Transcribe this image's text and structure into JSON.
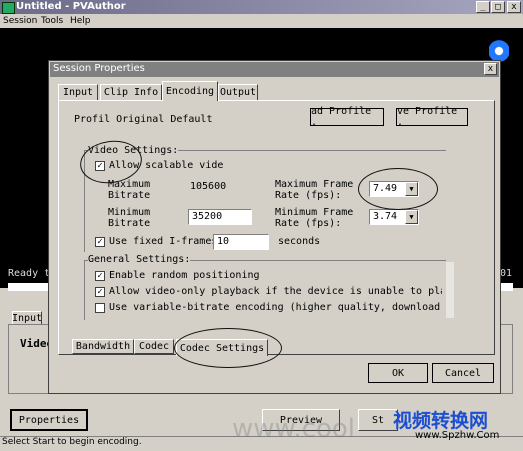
{
  "app": {
    "title": "Untitled - PVAuthor",
    "menu": [
      "Session",
      "Tools",
      "Help"
    ],
    "status_bar": "Select Start to begin encoding.",
    "video_status_left": "Ready t",
    "video_status_right": "01",
    "bottom_tab": "Input",
    "bottom_label": "Video",
    "properties_button": "Properties",
    "preview_button": "Preview",
    "start_button": "St",
    "window_controls": [
      "_",
      "□",
      "x"
    ]
  },
  "dialog": {
    "title": "Session Properties",
    "close": "x",
    "tabs": [
      "Input",
      "Clip Info",
      "Encoding",
      "Output"
    ],
    "active_tab": "Encoding",
    "profile_label": "Profil Original Default",
    "load_profile_button": "ad Profile .",
    "save_profile_button": "ve Profile .",
    "video_settings": {
      "legend": "Video Settings:",
      "allow_scalable": "Allow scalable vide",
      "allow_scalable_checked": true,
      "max_bitrate_label": "Maximum\nBitrate",
      "max_bitrate_value": "105600",
      "min_bitrate_label": "Minimum\nBitrate",
      "min_bitrate_value": "35200",
      "max_frame_rate_label": "Maximum Frame\nRate (fps):",
      "max_frame_rate_value": "7.49",
      "min_frame_rate_label": "Minimum Frame\nRate (fps):",
      "min_frame_rate_value": "3.74",
      "fixed_iframes_label": "Use fixed I-frames",
      "fixed_iframes_checked": true,
      "fixed_iframes_value": "10",
      "seconds_label": "seconds"
    },
    "general_settings": {
      "legend": "General Settings:",
      "items": [
        {
          "label": "Enable random positioning",
          "checked": true
        },
        {
          "label": "Allow video-only playback if the device is unable to play au",
          "checked": true
        },
        {
          "label": "Use variable-bitrate encoding (higher quality, download only",
          "checked": false
        }
      ]
    },
    "subtabs": [
      "Bandwidth",
      "Codec",
      "Codec Settings"
    ],
    "ok_button": "OK",
    "cancel_button": "Cancel"
  },
  "watermark": {
    "text": "www.cool",
    "logo_line1": "视频转换网",
    "logo_line2": "www.Spzhw.Com"
  }
}
